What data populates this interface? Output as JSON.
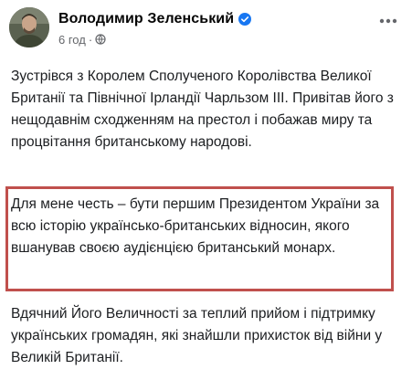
{
  "post": {
    "author": {
      "name": "Володимир Зеленський",
      "verified_icon": "verified-badge-icon",
      "avatar_icon": "profile-avatar"
    },
    "meta": {
      "time": "6 год",
      "separator": "·",
      "privacy_icon": "globe-icon"
    },
    "more_icon": "more-options-icon",
    "paragraphs": [
      "Зустрівся з Королем Сполученого Королівства Великої Британії та Північної Ірландії Чарльзом ІІІ. Привітав його з нещодавнім сходженням на престол і побажав миру та процвітання британському народові.",
      "Для мене честь – бути першим Президентом України за всю історію українсько-британських відносин, якого вшанував своєю аудієнцією британський монарх.",
      "Вдячний Його Величності за теплий прийом і підтримку українських громадян, які знайшли прихисток від війни у Великій Британії."
    ],
    "highlight_color": "#c0504d"
  }
}
